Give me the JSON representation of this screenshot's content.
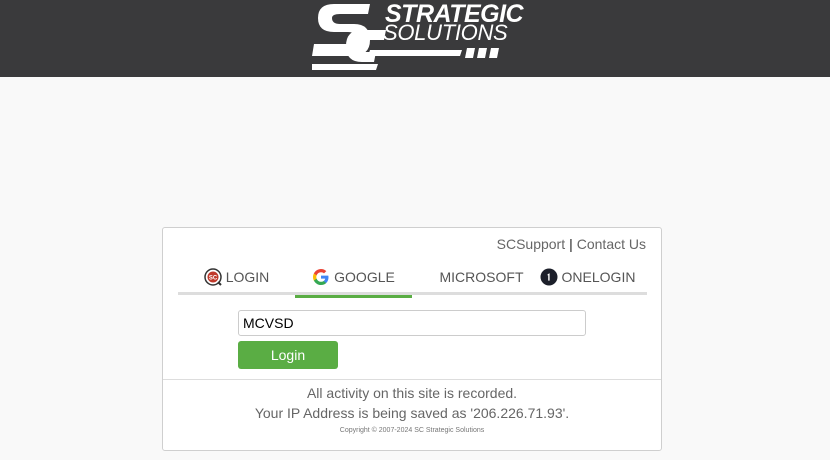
{
  "brand": {
    "line1": "STRATEGIC",
    "line2": "SOLUTIONS",
    "monogram": "SC",
    "colors": {
      "header_bg": "#3a3a3c",
      "logo": "#ffffff"
    }
  },
  "links": {
    "support": "SCSupport",
    "separator": "|",
    "contact": "Contact Us"
  },
  "tabs": [
    {
      "label": "LOGIN",
      "icon": "sc-logo-icon",
      "active": false
    },
    {
      "label": "GOOGLE",
      "icon": "google-icon",
      "active": true
    },
    {
      "label": "MICROSOFT",
      "icon": "microsoft-icon",
      "active": false
    },
    {
      "label": "ONELOGIN",
      "icon": "onelogin-icon",
      "active": false
    }
  ],
  "form": {
    "organization_value": "MCVSD",
    "login_label": "Login"
  },
  "footer": {
    "notice": "All activity on this site is recorded.",
    "ip_notice": "Your IP Address is being saved as '206.226.71.93'.",
    "copyright": "Copyright © 2007-2024 SC Strategic Solutions"
  },
  "colors": {
    "accent": "#5aad44",
    "google_blue": "#4285f4",
    "google_red": "#ea4335",
    "google_yellow": "#fbbc05",
    "google_green": "#34a853",
    "ms_red": "#f25022",
    "ms_green": "#7fba00",
    "ms_blue": "#00a4ef",
    "ms_yellow": "#ffb900"
  }
}
